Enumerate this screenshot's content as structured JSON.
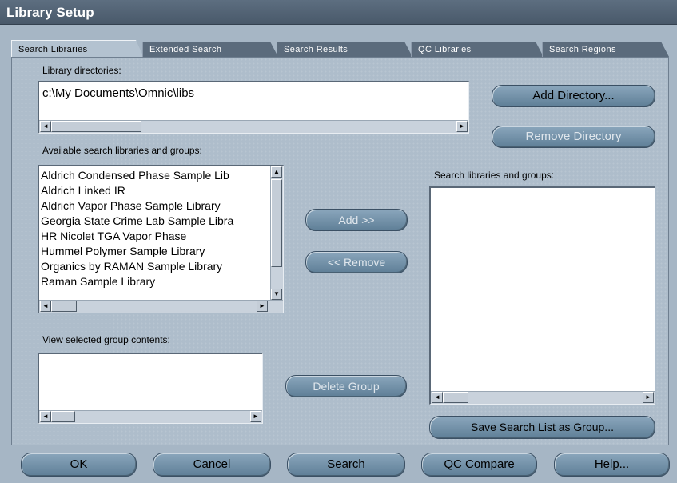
{
  "window": {
    "title": "Library Setup"
  },
  "tabs": [
    {
      "label": "Search Libraries",
      "active": true
    },
    {
      "label": "Extended Search",
      "active": false
    },
    {
      "label": "Search Results",
      "active": false
    },
    {
      "label": "QC Libraries",
      "active": false
    },
    {
      "label": "Search Regions",
      "active": false
    }
  ],
  "directories": {
    "label": "Library directories:",
    "items": [
      "c:\\My Documents\\Omnic\\libs"
    ],
    "add_button": "Add Directory...",
    "remove_button": "Remove Directory"
  },
  "available": {
    "label": "Available search libraries and groups:",
    "items": [
      "Aldrich Condensed Phase Sample Lib",
      "Aldrich Linked IR",
      "Aldrich Vapor Phase Sample Library",
      "Georgia State Crime Lab Sample Libra",
      "HR Nicolet TGA Vapor Phase",
      "Hummel Polymer Sample Library",
      "Organics by RAMAN Sample Library",
      "Raman Sample Library"
    ]
  },
  "transfer": {
    "add_button": "Add >>",
    "remove_button": "<< Remove"
  },
  "group_contents": {
    "label": "View selected group contents:",
    "delete_button": "Delete Group"
  },
  "search_list": {
    "label": "Search libraries and groups:",
    "save_button": "Save Search List as Group..."
  },
  "footer": {
    "ok": "OK",
    "cancel": "Cancel",
    "search": "Search",
    "qc_compare": "QC Compare",
    "help": "Help..."
  },
  "glyphs": {
    "left": "◄",
    "right": "►",
    "up": "▲",
    "down": "▼"
  }
}
